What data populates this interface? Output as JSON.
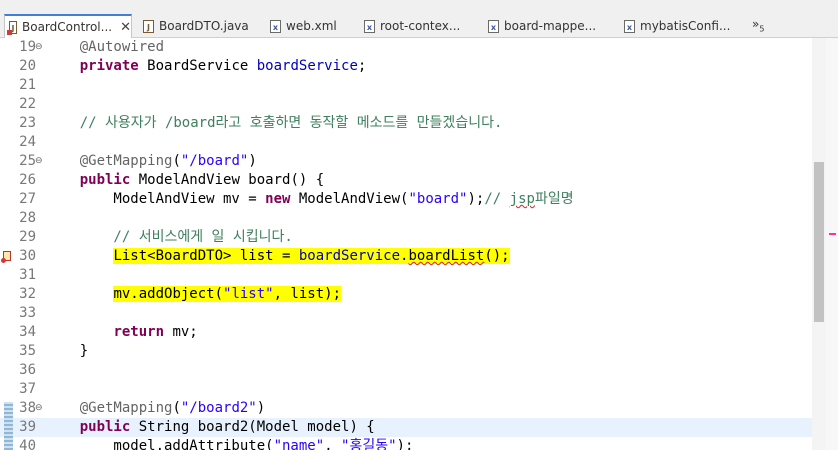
{
  "tabs": [
    {
      "label": "BoardControl...",
      "close": "✕",
      "active": true
    },
    {
      "label": "BoardDTO.java"
    },
    {
      "label": "web.xml"
    },
    {
      "label": "root-contex..."
    },
    {
      "label": "board-mappe..."
    },
    {
      "label": "mybatisConfi..."
    }
  ],
  "tab_overflow": {
    "symbol": "»",
    "count": "5"
  },
  "editor": {
    "lines": [
      {
        "num": "19",
        "text": "    @Autowired"
      },
      {
        "num": "20",
        "text": "    private BoardService boardService;"
      },
      {
        "num": "21",
        "text": ""
      },
      {
        "num": "22",
        "text": ""
      },
      {
        "num": "23",
        "text": "    // 사용자가 /board라고 호출하면 동작할 메소드를 만들겠습니다."
      },
      {
        "num": "24",
        "text": ""
      },
      {
        "num": "25",
        "text": "    @GetMapping(\"/board\")"
      },
      {
        "num": "26",
        "text": "    public ModelAndView board() {"
      },
      {
        "num": "27",
        "text": "        ModelAndView mv = new ModelAndView(\"board\");// jsp파일명"
      },
      {
        "num": "28",
        "text": ""
      },
      {
        "num": "29",
        "text": "        // 서비스에게 일 시킵니다."
      },
      {
        "num": "30",
        "text": "        List<BoardDTO> list = boardService.boardList();"
      },
      {
        "num": "31",
        "text": ""
      },
      {
        "num": "32",
        "text": "        mv.addObject(\"list\", list);"
      },
      {
        "num": "33",
        "text": ""
      },
      {
        "num": "34",
        "text": "        return mv;"
      },
      {
        "num": "35",
        "text": "    }"
      },
      {
        "num": "36",
        "text": ""
      },
      {
        "num": "37",
        "text": ""
      },
      {
        "num": "38",
        "text": "    @GetMapping(\"/board2\")"
      },
      {
        "num": "39",
        "text": "    public String board2(Model model) {"
      },
      {
        "num": "40",
        "text": "        model.addAttribute(\"name\", \"홍길동\");"
      }
    ],
    "fold_marker": "⊖",
    "highlight_color": "#ffff00",
    "current_line_color": "#e8f2fe"
  },
  "colors": {
    "keyword": "#7f0055",
    "annotation": "#646464",
    "string": "#2a00ff",
    "comment": "#3f7f5f",
    "field": "#0000c0"
  }
}
